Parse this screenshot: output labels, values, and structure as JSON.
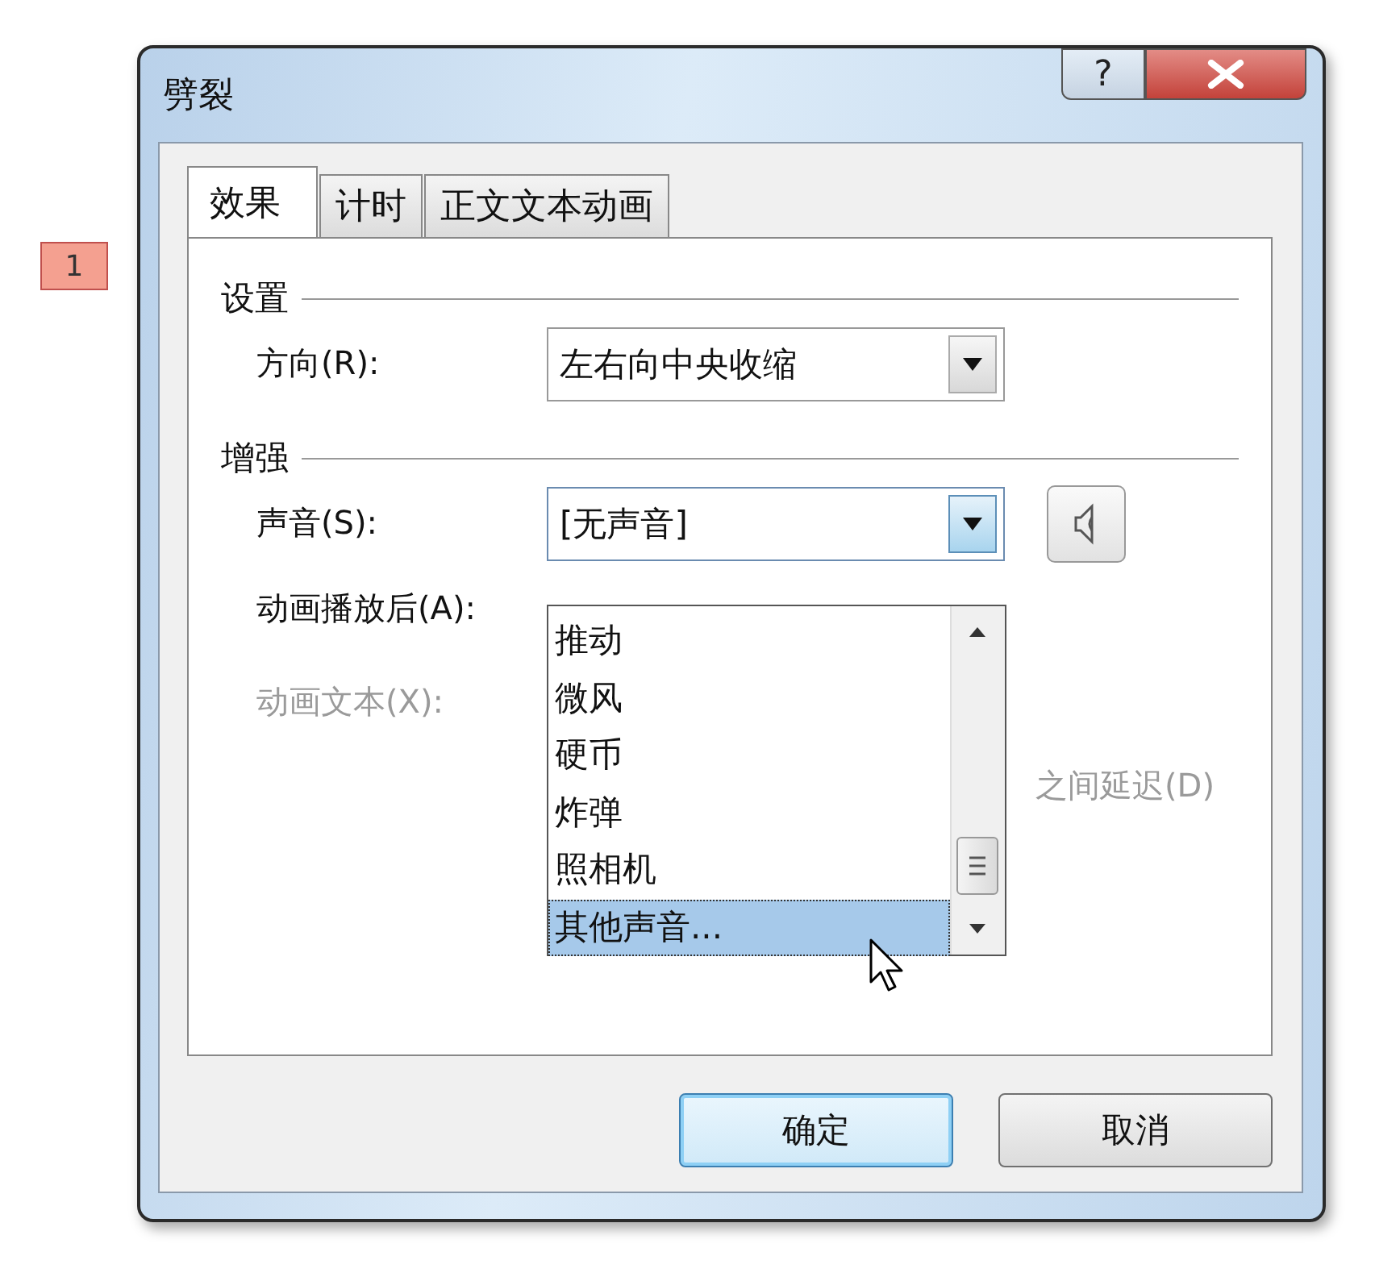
{
  "callout": "1",
  "window": {
    "title": "劈裂",
    "help_button": "?"
  },
  "tabs": [
    {
      "label": "效果",
      "selected": true
    },
    {
      "label": "计时",
      "selected": false
    },
    {
      "label": "正文文本动画",
      "selected": false
    }
  ],
  "settings": {
    "heading": "设置",
    "direction": {
      "label": "方向(R):",
      "value": "左右向中央收缩"
    }
  },
  "enhancements": {
    "heading": "增强",
    "sound": {
      "label": "声音(S):",
      "value": "[无声音]",
      "expanded": true
    },
    "rows": [
      {
        "label": "动画播放后(A):",
        "disabled": false
      },
      {
        "label": "动画文本(X):",
        "disabled": true
      }
    ],
    "delay_label": "之间延迟(D)"
  },
  "sound_list": [
    {
      "label": "推动",
      "selected": false
    },
    {
      "label": "微风",
      "selected": false
    },
    {
      "label": "硬币",
      "selected": false
    },
    {
      "label": "炸弹",
      "selected": false
    },
    {
      "label": "照相机",
      "selected": false
    },
    {
      "label": "其他声音...",
      "selected": true
    }
  ],
  "buttons": [
    {
      "label": "确定",
      "default": true
    },
    {
      "label": "取消",
      "default": false
    }
  ]
}
